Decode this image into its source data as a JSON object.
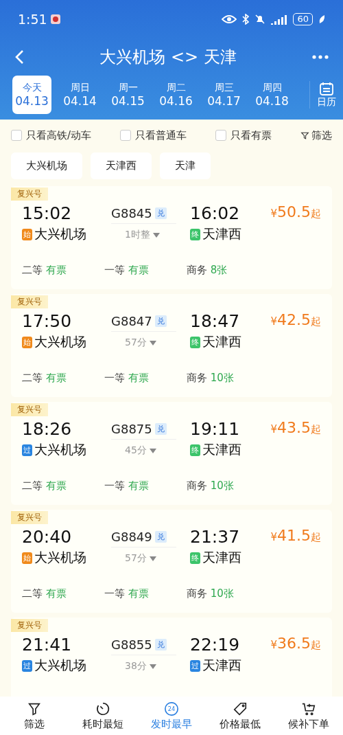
{
  "status_bar": {
    "time": "1:51",
    "battery": "60"
  },
  "header": {
    "title": "大兴机场 <> 天津"
  },
  "dates": [
    {
      "weekday": "今天",
      "date": "04.13",
      "selected": true
    },
    {
      "weekday": "周日",
      "date": "04.14",
      "selected": false
    },
    {
      "weekday": "周一",
      "date": "04.15",
      "selected": false
    },
    {
      "weekday": "周二",
      "date": "04.16",
      "selected": false
    },
    {
      "weekday": "周三",
      "date": "04.17",
      "selected": false
    },
    {
      "weekday": "周四",
      "date": "04.18",
      "selected": false
    }
  ],
  "calendar_label": "日历",
  "filters": [
    {
      "label": "只看高铁/动车",
      "checked": false
    },
    {
      "label": "只看普通车",
      "checked": false
    },
    {
      "label": "只看有票",
      "checked": false
    }
  ],
  "filter_button": "筛选",
  "stations": [
    "大兴机场",
    "天津西",
    "天津"
  ],
  "trains": [
    {
      "badge": "复兴号",
      "depart": "15:02",
      "number": "G8845",
      "tag": "兑",
      "arrive": "16:02",
      "price_symbol": "¥",
      "price": "50.5",
      "price_suffix": "起",
      "from": {
        "tag": "始",
        "name": "大兴机场",
        "color": "#f08a1c"
      },
      "duration": "1时整",
      "to": {
        "tag": "终",
        "name": "天津西",
        "color": "#3cc46a"
      },
      "seats": [
        {
          "class": "二等",
          "avail": "有票"
        },
        {
          "class": "一等",
          "avail": "有票"
        },
        {
          "class": "商务",
          "avail": "8张"
        }
      ]
    },
    {
      "badge": "复兴号",
      "depart": "17:50",
      "number": "G8847",
      "tag": "兑",
      "arrive": "18:47",
      "price_symbol": "¥",
      "price": "42.5",
      "price_suffix": "起",
      "from": {
        "tag": "始",
        "name": "大兴机场",
        "color": "#f08a1c"
      },
      "duration": "57分",
      "to": {
        "tag": "终",
        "name": "天津西",
        "color": "#3cc46a"
      },
      "seats": [
        {
          "class": "二等",
          "avail": "有票"
        },
        {
          "class": "一等",
          "avail": "有票"
        },
        {
          "class": "商务",
          "avail": "10张"
        }
      ]
    },
    {
      "badge": "复兴号",
      "depart": "18:26",
      "number": "G8875",
      "tag": "兑",
      "arrive": "19:11",
      "price_symbol": "¥",
      "price": "43.5",
      "price_suffix": "起",
      "from": {
        "tag": "过",
        "name": "大兴机场",
        "color": "#2a85e0"
      },
      "duration": "45分",
      "to": {
        "tag": "终",
        "name": "天津西",
        "color": "#3cc46a"
      },
      "seats": [
        {
          "class": "二等",
          "avail": "有票"
        },
        {
          "class": "一等",
          "avail": "有票"
        },
        {
          "class": "商务",
          "avail": "10张"
        }
      ]
    },
    {
      "badge": "复兴号",
      "depart": "20:40",
      "number": "G8849",
      "tag": "兑",
      "arrive": "21:37",
      "price_symbol": "¥",
      "price": "41.5",
      "price_suffix": "起",
      "from": {
        "tag": "始",
        "name": "大兴机场",
        "color": "#f08a1c"
      },
      "duration": "57分",
      "to": {
        "tag": "终",
        "name": "天津西",
        "color": "#3cc46a"
      },
      "seats": [
        {
          "class": "二等",
          "avail": "有票"
        },
        {
          "class": "一等",
          "avail": "有票"
        },
        {
          "class": "商务",
          "avail": "10张"
        }
      ]
    },
    {
      "badge": "复兴号",
      "depart": "21:41",
      "number": "G8855",
      "tag": "兑",
      "arrive": "22:19",
      "price_symbol": "¥",
      "price": "36.5",
      "price_suffix": "起",
      "from": {
        "tag": "过",
        "name": "大兴机场",
        "color": "#2a85e0"
      },
      "duration": "38分",
      "to": {
        "tag": "过",
        "name": "天津西",
        "color": "#2a85e0"
      }
    }
  ],
  "bottom_nav": [
    {
      "kind": "filter",
      "label": "筛选",
      "selected": false
    },
    {
      "kind": "timer",
      "label": "耗时最短",
      "selected": false
    },
    {
      "kind": "clock24",
      "icon_text": "24",
      "label": "发时最早",
      "selected": true
    },
    {
      "kind": "tag",
      "label": "价格最低",
      "selected": false
    },
    {
      "kind": "cart",
      "label": "候补下单",
      "selected": false
    }
  ]
}
